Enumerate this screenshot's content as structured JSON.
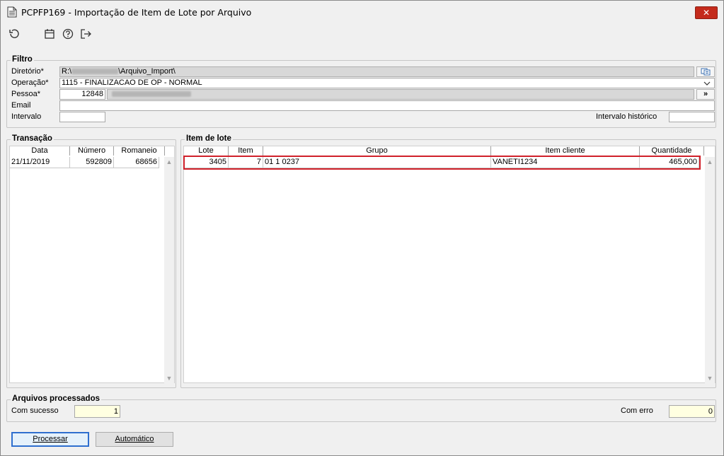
{
  "window": {
    "title": "PCPFP169 - Importação de Item de Lote por Arquivo",
    "close_label": "✕"
  },
  "toolbar": {
    "icons": [
      "refresh-icon",
      "calendar-icon",
      "help-icon",
      "exit-icon"
    ]
  },
  "filtro": {
    "label": "Filtro",
    "diretorio_label": "Diretório*",
    "diretorio_prefix": "R:\\",
    "diretorio_suffix": "\\Arquivo_Import\\",
    "operacao_label": "Operação*",
    "operacao_value": "1115 - FINALIZACAO DE OP - NORMAL",
    "pessoa_label": "Pessoa*",
    "pessoa_code": "12848",
    "pessoa_btn": "»",
    "email_label": "Email",
    "email_value": "",
    "intervalo_label": "Intervalo",
    "intervalo_value": "",
    "intervalo_hist_label": "Intervalo histórico",
    "intervalo_hist_value": ""
  },
  "transacao": {
    "label": "Transação",
    "columns": [
      "Data",
      "Número",
      "Romaneio"
    ],
    "rows": [
      {
        "data": "21/11/2019",
        "numero": "592809",
        "romaneio": "68656"
      }
    ]
  },
  "item_lote": {
    "label": "Item de lote",
    "columns": [
      "Lote",
      "Item",
      "Grupo",
      "Item cliente",
      "Quantidade"
    ],
    "rows": [
      {
        "lote": "3405",
        "item": "7",
        "grupo": "01 1 0237",
        "item_cliente": "VANETI1234",
        "quantidade": "465,000"
      }
    ],
    "highlight_color": "#d0202a"
  },
  "arquivos": {
    "label": "Arquivos processados",
    "sucesso_label": "Com sucesso",
    "sucesso_value": "1",
    "erro_label": "Com erro",
    "erro_value": "0"
  },
  "buttons": {
    "processar": "Processar",
    "automatico": "Automático"
  }
}
